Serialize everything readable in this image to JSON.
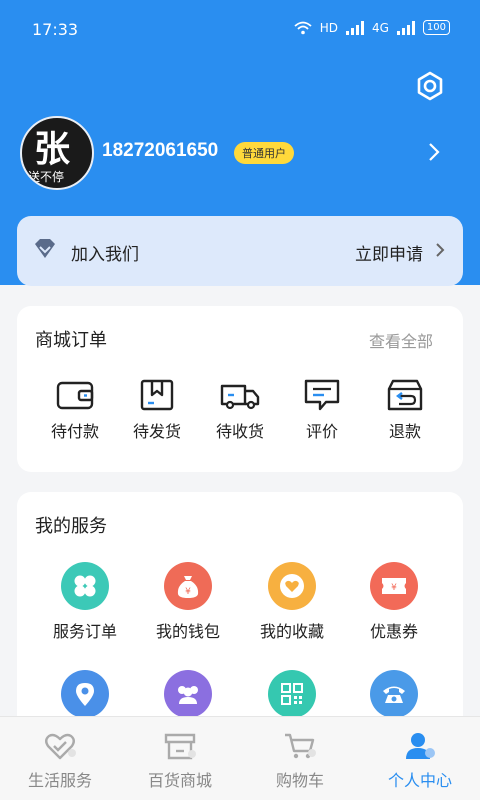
{
  "status_bar": {
    "time": "17:33",
    "network": "HD",
    "cellular": "4G",
    "battery": "100"
  },
  "profile": {
    "avatar_glyph": "张",
    "avatar_caption": "送不停",
    "phone": "18272061650",
    "badge": "普通用户"
  },
  "join_banner": {
    "title": "加入我们",
    "action": "立即申请"
  },
  "orders": {
    "title": "商城订单",
    "view_all": "查看全部",
    "items": [
      {
        "label": "待付款",
        "icon": "wallet-icon"
      },
      {
        "label": "待发货",
        "icon": "package-icon"
      },
      {
        "label": "待收货",
        "icon": "truck-icon"
      },
      {
        "label": "评价",
        "icon": "comment-icon"
      },
      {
        "label": "退款",
        "icon": "return-box-icon"
      }
    ]
  },
  "services": {
    "title": "我的服务",
    "items": [
      {
        "label": "服务订单",
        "icon": "clover-icon",
        "color": "#3cc9b7"
      },
      {
        "label": "我的钱包",
        "icon": "money-bag-icon",
        "color": "#ef6b57"
      },
      {
        "label": "我的收藏",
        "icon": "heart-icon",
        "color": "#f7b040"
      },
      {
        "label": "优惠券",
        "icon": "coupon-icon",
        "color": "#f26a58"
      },
      {
        "label": "",
        "icon": "location-icon",
        "color": "#4a90e8"
      },
      {
        "label": "",
        "icon": "group-icon",
        "color": "#8b6fe0"
      },
      {
        "label": "",
        "icon": "qr-code-icon",
        "color": "#35c8b0"
      },
      {
        "label": "",
        "icon": "telephone-icon",
        "color": "#4a9ae8"
      }
    ]
  },
  "tabs": [
    {
      "label": "生活服务",
      "icon": "heart-outline-icon",
      "active": false
    },
    {
      "label": "百货商城",
      "icon": "store-icon",
      "active": false
    },
    {
      "label": "购物车",
      "icon": "cart-icon",
      "active": false
    },
    {
      "label": "个人中心",
      "icon": "person-icon",
      "active": true
    }
  ],
  "colors": {
    "primary": "#2a8ef0",
    "badge": "#ffd93b",
    "join_bg": "#dde9fb"
  }
}
